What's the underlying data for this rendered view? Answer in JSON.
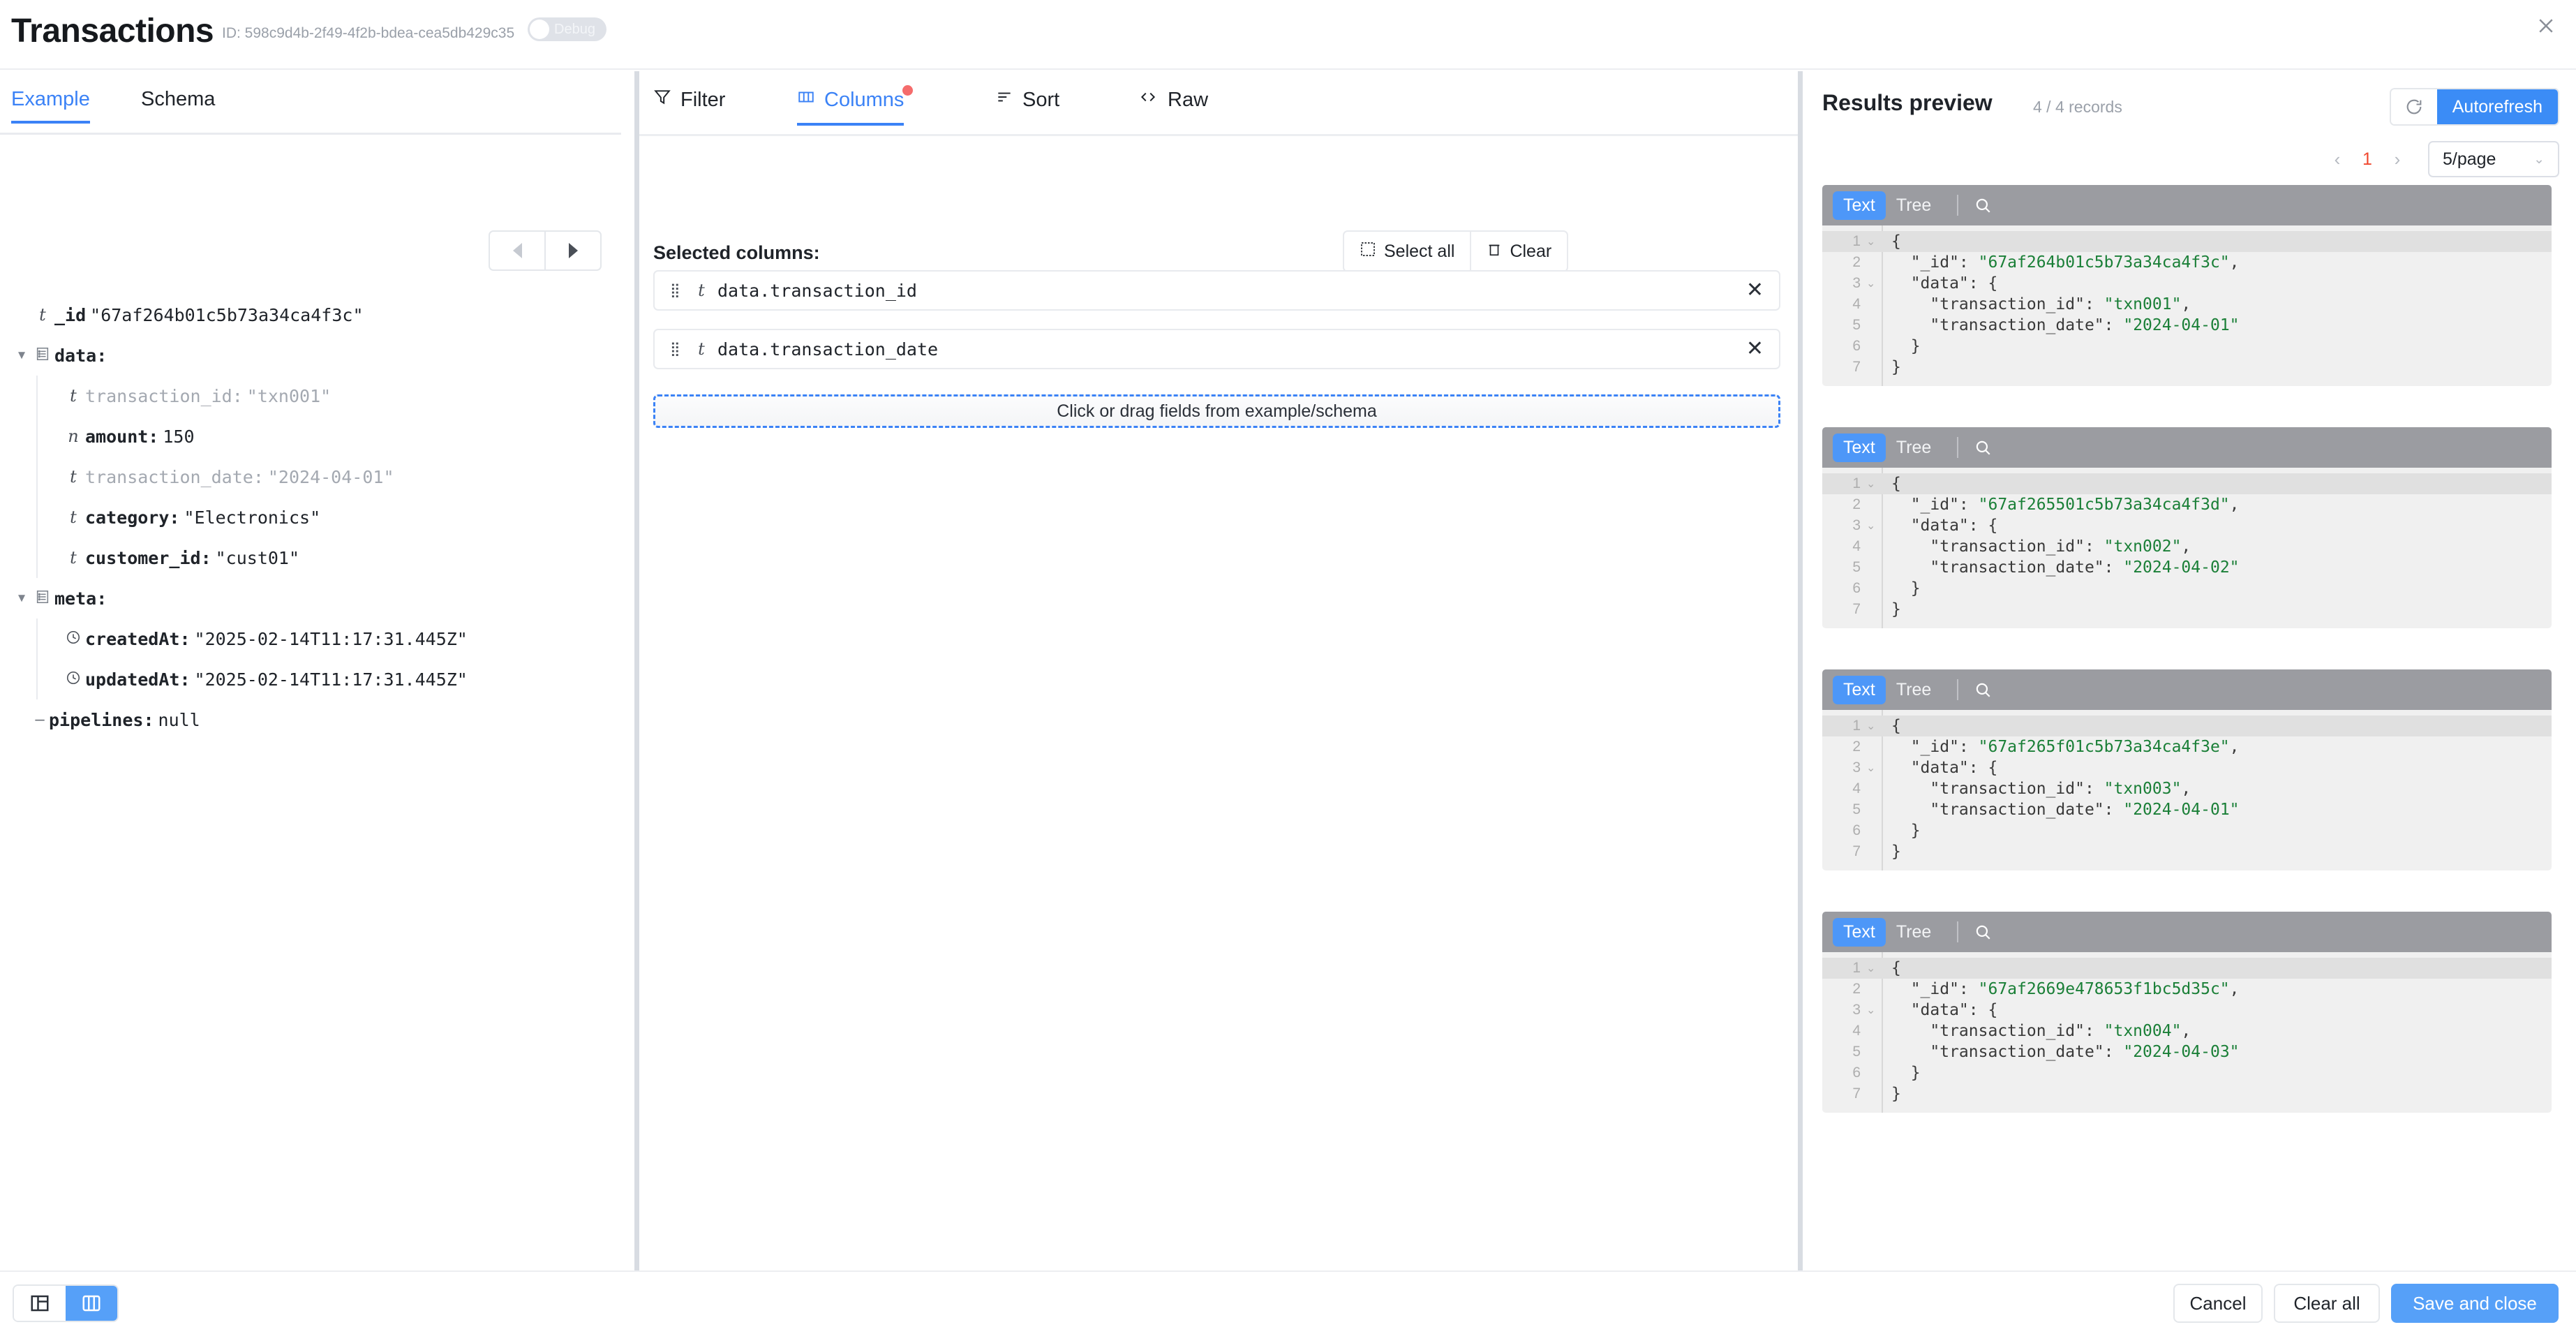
{
  "header": {
    "title": "Transactions",
    "id_label": "ID: 598c9d4b-2f49-4f2b-bdea-cea5db429c35",
    "debug_label": "Debug",
    "close_icon": "close-icon"
  },
  "left_panel": {
    "tabs": [
      {
        "label": "Example",
        "active": true
      },
      {
        "label": "Schema",
        "active": false
      }
    ],
    "pager": {
      "prev": "prev-arrow",
      "next": "next-arrow"
    },
    "tree": [
      {
        "indent": 0,
        "caret": "",
        "type_icon": "t",
        "key": "_id",
        "value": "\"67af264b01c5b73a34ca4f3c\"",
        "dim": false
      },
      {
        "indent": 0,
        "caret": "▼",
        "type_icon": "object",
        "key": "data:",
        "value": "",
        "dim": false
      },
      {
        "indent": 1,
        "caret": "",
        "type_icon": "t",
        "key": "transaction_id:",
        "value": "\"txn001\"",
        "dim": true
      },
      {
        "indent": 1,
        "caret": "",
        "type_icon": "n",
        "key": "amount:",
        "value": "150",
        "dim": false
      },
      {
        "indent": 1,
        "caret": "",
        "type_icon": "t",
        "key": "transaction_date:",
        "value": "\"2024-04-01\"",
        "dim": true
      },
      {
        "indent": 1,
        "caret": "",
        "type_icon": "t",
        "key": "category:",
        "value": "\"Electronics\"",
        "dim": false
      },
      {
        "indent": 1,
        "caret": "",
        "type_icon": "t",
        "key": "customer_id:",
        "value": "\"cust01\"",
        "dim": false
      },
      {
        "indent": 0,
        "caret": "▼",
        "type_icon": "object",
        "key": "meta:",
        "value": "",
        "dim": false
      },
      {
        "indent": 1,
        "caret": "",
        "type_icon": "clock",
        "key": "createdAt:",
        "value": "\"2025-02-14T11:17:31.445Z\"",
        "dim": false
      },
      {
        "indent": 1,
        "caret": "",
        "type_icon": "clock",
        "key": "updatedAt:",
        "value": "\"2025-02-14T11:17:31.445Z\"",
        "dim": false
      },
      {
        "indent": 0,
        "caret": "",
        "type_icon": "dash",
        "key": "pipelines:",
        "value": "null",
        "dim": false
      }
    ]
  },
  "middle_panel": {
    "tabs": [
      {
        "label": "Filter",
        "icon": "filter-icon",
        "active": false,
        "badge": false
      },
      {
        "label": "Columns",
        "icon": "columns-icon",
        "active": true,
        "badge": true
      },
      {
        "label": "Sort",
        "icon": "sort-icon",
        "active": false,
        "badge": false
      },
      {
        "label": "Raw",
        "icon": "code-icon",
        "active": false,
        "badge": false
      }
    ],
    "selected_columns_label": "Selected columns:",
    "select_all_label": "Select all",
    "clear_label": "Clear",
    "columns": [
      {
        "type_icon": "t",
        "name": "data.transaction_id"
      },
      {
        "type_icon": "t",
        "name": "data.transaction_date"
      }
    ],
    "dropzone_label": "Click or drag fields from example/schema"
  },
  "right_panel": {
    "title": "Results preview",
    "record_count": "4 / 4 records",
    "refresh_icon": "refresh-icon",
    "autorefresh_label": "Autorefresh",
    "pagination": {
      "prev": "‹",
      "page": "1",
      "next": "›"
    },
    "page_size": "5/page",
    "card_tabs": {
      "text": "Text",
      "tree": "Tree",
      "search_icon": "search-icon"
    },
    "records": [
      {
        "lines": [
          {
            "n": "1",
            "fold": "⌄",
            "text": "{",
            "highlight": true
          },
          {
            "n": "2",
            "fold": "",
            "text": "  \"_id\": \"67af264b01c5b73a34ca4f3c\",",
            "highlight": false
          },
          {
            "n": "3",
            "fold": "⌄",
            "text": "  \"data\": {",
            "highlight": false
          },
          {
            "n": "4",
            "fold": "",
            "text": "    \"transaction_id\": \"txn001\",",
            "highlight": false
          },
          {
            "n": "5",
            "fold": "",
            "text": "    \"transaction_date\": \"2024-04-01\"",
            "highlight": false
          },
          {
            "n": "6",
            "fold": "",
            "text": "  }",
            "highlight": false
          },
          {
            "n": "7",
            "fold": "",
            "text": "}",
            "highlight": false
          }
        ]
      },
      {
        "lines": [
          {
            "n": "1",
            "fold": "⌄",
            "text": "{",
            "highlight": true
          },
          {
            "n": "2",
            "fold": "",
            "text": "  \"_id\": \"67af265501c5b73a34ca4f3d\",",
            "highlight": false
          },
          {
            "n": "3",
            "fold": "⌄",
            "text": "  \"data\": {",
            "highlight": false
          },
          {
            "n": "4",
            "fold": "",
            "text": "    \"transaction_id\": \"txn002\",",
            "highlight": false
          },
          {
            "n": "5",
            "fold": "",
            "text": "    \"transaction_date\": \"2024-04-02\"",
            "highlight": false
          },
          {
            "n": "6",
            "fold": "",
            "text": "  }",
            "highlight": false
          },
          {
            "n": "7",
            "fold": "",
            "text": "}",
            "highlight": false
          }
        ]
      },
      {
        "lines": [
          {
            "n": "1",
            "fold": "⌄",
            "text": "{",
            "highlight": true
          },
          {
            "n": "2",
            "fold": "",
            "text": "  \"_id\": \"67af265f01c5b73a34ca4f3e\",",
            "highlight": false
          },
          {
            "n": "3",
            "fold": "⌄",
            "text": "  \"data\": {",
            "highlight": false
          },
          {
            "n": "4",
            "fold": "",
            "text": "    \"transaction_id\": \"txn003\",",
            "highlight": false
          },
          {
            "n": "5",
            "fold": "",
            "text": "    \"transaction_date\": \"2024-04-01\"",
            "highlight": false
          },
          {
            "n": "6",
            "fold": "",
            "text": "  }",
            "highlight": false
          },
          {
            "n": "7",
            "fold": "",
            "text": "}",
            "highlight": false
          }
        ]
      },
      {
        "lines": [
          {
            "n": "1",
            "fold": "⌄",
            "text": "{",
            "highlight": true
          },
          {
            "n": "2",
            "fold": "",
            "text": "  \"_id\": \"67af2669e478653f1bc5d35c\",",
            "highlight": false
          },
          {
            "n": "3",
            "fold": "⌄",
            "text": "  \"data\": {",
            "highlight": false
          },
          {
            "n": "4",
            "fold": "",
            "text": "    \"transaction_id\": \"txn004\",",
            "highlight": false
          },
          {
            "n": "5",
            "fold": "",
            "text": "    \"transaction_date\": \"2024-04-03\"",
            "highlight": false
          },
          {
            "n": "6",
            "fold": "",
            "text": "  }",
            "highlight": false
          },
          {
            "n": "7",
            "fold": "",
            "text": "}",
            "highlight": false
          }
        ]
      }
    ]
  },
  "footer": {
    "layout_split_icon": "layout-split-icon",
    "layout_columns_icon": "layout-columns-icon",
    "cancel_label": "Cancel",
    "clear_all_label": "Clear all",
    "save_label": "Save and close"
  },
  "colors": {
    "accent": "#3b82f6",
    "primary_button": "#56a0f8",
    "badge": "#f56c6c",
    "page_active": "#f0482f",
    "string_green": "#1a7f37"
  }
}
